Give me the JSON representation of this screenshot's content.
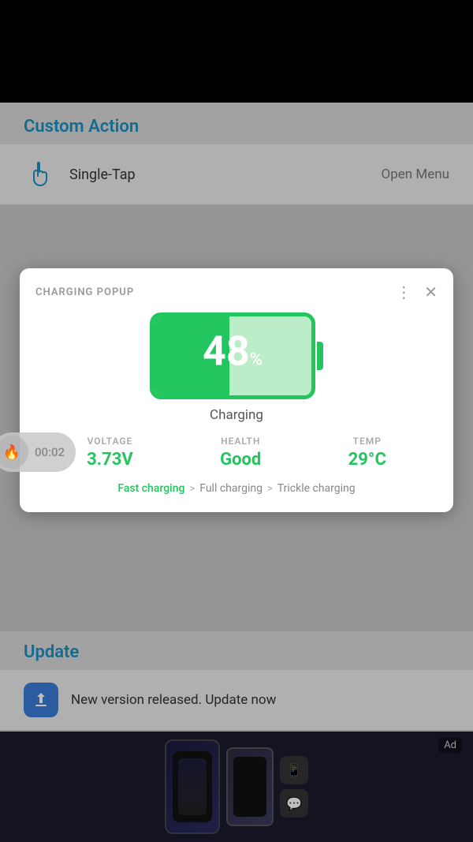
{
  "app": {
    "top_bar_height": 130
  },
  "custom_action": {
    "section_title": "Custom Action",
    "single_tap_label": "Single-Tap",
    "single_tap_value": "Open Menu"
  },
  "popup": {
    "title": "CHARGING POPUP",
    "battery_percent": "48",
    "battery_symbol": "%",
    "battery_status": "Charging",
    "voltage_label": "VOLTAGE",
    "voltage_value": "3.73V",
    "health_label": "HEALTH",
    "health_value": "Good",
    "temp_label": "TEMP",
    "temp_value": "29°C",
    "stage_active": "Fast charging",
    "stage_arrow1": ">",
    "stage_2": "Full charging",
    "stage_arrow2": ">",
    "stage_3": "Trickle charging"
  },
  "timer": {
    "time": "00:02"
  },
  "update": {
    "section_title": "Update",
    "update_text": "New version released. Update now"
  },
  "ad": {
    "label": "Ad"
  }
}
